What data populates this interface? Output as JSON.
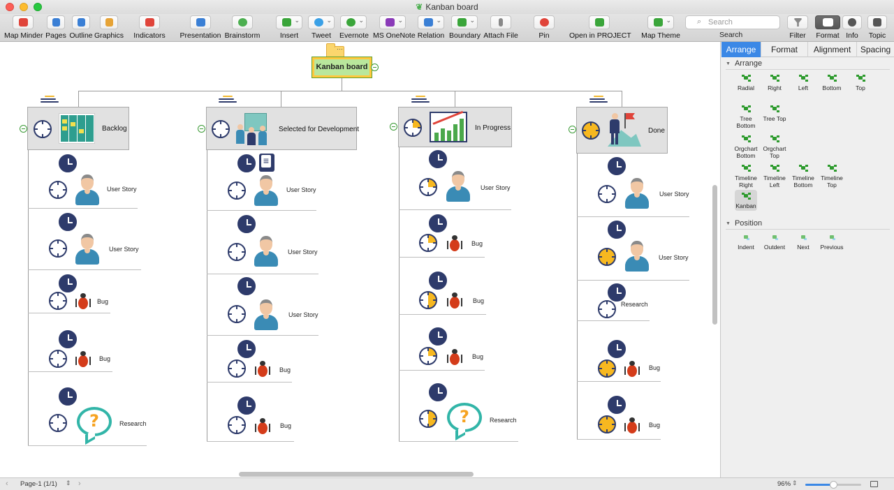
{
  "window": {
    "title": "Kanban board"
  },
  "toolbar": {
    "items": [
      {
        "label": "Map Minder",
        "icon": "map-minder-icon",
        "color": "#e0443a"
      },
      {
        "label": "Pages",
        "icon": "pages-icon",
        "color": "#3a7fd5"
      },
      {
        "label": "Outline",
        "icon": "outline-icon",
        "color": "#3a7fd5"
      },
      {
        "label": "Graphics",
        "icon": "graphics-icon",
        "color": "#e6a336"
      },
      {
        "label": "Indicators",
        "icon": "indicators-icon",
        "color": "#e0443a"
      },
      {
        "label": "Presentation",
        "icon": "presentation-icon",
        "color": "#3a7fd5"
      },
      {
        "label": "Brainstorm",
        "icon": "brainstorm-icon",
        "color": "#4caf50"
      },
      {
        "label": "Insert",
        "icon": "insert-icon",
        "color": "#3aa53a"
      },
      {
        "label": "Tweet",
        "icon": "tweet-icon",
        "color": "#3aa0e6"
      },
      {
        "label": "Evernote",
        "icon": "evernote-icon",
        "color": "#3aa53a"
      },
      {
        "label": "MS OneNote",
        "icon": "onenote-icon",
        "color": "#8a3ab8"
      },
      {
        "label": "Relation",
        "icon": "relation-icon",
        "color": "#3a7fd5"
      },
      {
        "label": "Boundary",
        "icon": "boundary-icon",
        "color": "#3aa53a"
      },
      {
        "label": "Attach File",
        "icon": "attach-file-icon",
        "color": "#888888"
      },
      {
        "label": "Pin",
        "icon": "pin-icon",
        "color": "#e0443a"
      },
      {
        "label": "Open in PROJECT",
        "icon": "project-icon",
        "color": "#3aa53a"
      },
      {
        "label": "Map Theme",
        "icon": "map-theme-icon",
        "color": "#3aa53a"
      },
      {
        "label": "Filter",
        "icon": "filter-icon",
        "color": "#888888"
      },
      {
        "label": "Format",
        "icon": "format-icon",
        "color": "#ffffff"
      },
      {
        "label": "Info",
        "icon": "info-icon",
        "color": "#555555"
      },
      {
        "label": "Topic",
        "icon": "topic-icon",
        "color": "#555555"
      }
    ],
    "search": {
      "placeholder": "Search",
      "label": "Search"
    }
  },
  "map": {
    "root": "Kanban board",
    "columns": [
      {
        "title": "Backlog",
        "cards": [
          "User Story",
          "User Story",
          "Bug",
          "Bug",
          "Research"
        ]
      },
      {
        "title": "Selected for Development",
        "cards": [
          "User Story",
          "User Story",
          "User Story",
          "Bug",
          "Bug"
        ]
      },
      {
        "title": "In Progress",
        "cards": [
          "User Story",
          "Bug",
          "Bug",
          "Bug",
          "Research"
        ]
      },
      {
        "title": "Done",
        "cards": [
          "User Story",
          "User Story",
          "Research",
          "Bug",
          "Bug"
        ]
      }
    ]
  },
  "panel": {
    "tabs": [
      "Arrange",
      "Format",
      "Alignment",
      "Spacing"
    ],
    "active_tab": "Arrange",
    "arrange_title": "Arrange",
    "arrange_items": [
      "Radial",
      "Right",
      "Left",
      "Bottom",
      "Top",
      "Tree Bottom",
      "Tree Top",
      "Orgchart Bottom",
      "Orgchart Top",
      "Timeline Right",
      "Timeline Left",
      "Timeline Bottom",
      "Timeline Top",
      "Kanban"
    ],
    "selected_layout": "Kanban",
    "position_title": "Position",
    "position_items": [
      "Indent",
      "Outdent",
      "Next",
      "Previous"
    ]
  },
  "status": {
    "page": "Page-1 (1/1)",
    "zoom": "96%",
    "zoom_level": 0.5
  },
  "colors": {
    "accent": "#3b88e6",
    "root_fill": "#b9e79c",
    "root_border": "#ffc83d",
    "clock": "#2e3b6b",
    "progress": "#f7b820"
  }
}
